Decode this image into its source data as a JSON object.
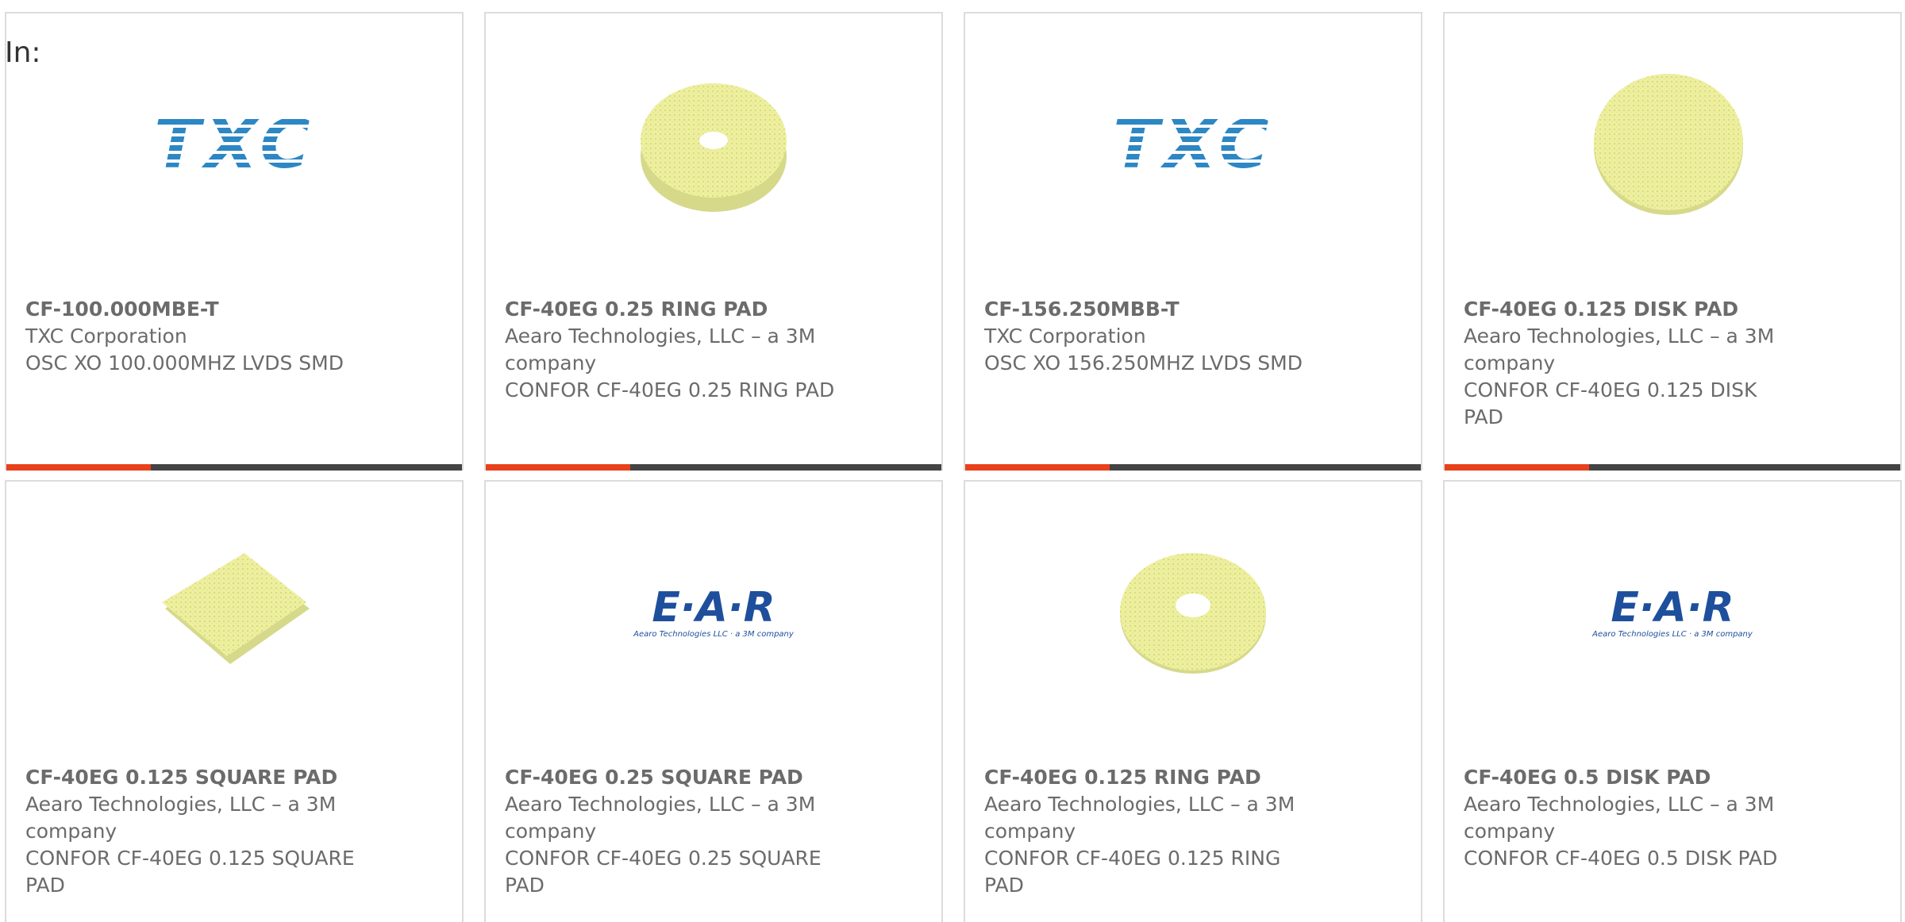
{
  "header": {
    "in_label": "In:"
  },
  "colors": {
    "accent": "#e8411c",
    "bar": "#444444",
    "txc_blue": "#2c87c4",
    "ear_blue": "#1e4f9c",
    "foam": "#eef0a0"
  },
  "products": [
    {
      "part": "CF-100.000MBE-T",
      "maker": "TXC Corporation",
      "desc": "OSC XO 100.000MHZ LVDS SMD",
      "image": "txc-logo",
      "logo_text": "TXC"
    },
    {
      "part": "CF-40EG 0.25 RING PAD",
      "maker": "Aearo Technologies, LLC – a 3M company",
      "desc": "CONFOR CF-40EG 0.25 RING PAD",
      "image": "foam-ring"
    },
    {
      "part": "CF-156.250MBB-T",
      "maker": "TXC Corporation",
      "desc": "OSC XO 156.250MHZ LVDS SMD",
      "image": "txc-logo",
      "logo_text": "TXC"
    },
    {
      "part": "CF-40EG 0.125 DISK PAD",
      "maker": "Aearo Technologies, LLC – a 3M company",
      "desc": "CONFOR CF-40EG 0.125 DISK PAD",
      "image": "foam-disk"
    },
    {
      "part": "CF-40EG 0.125 SQUARE PAD",
      "maker": "Aearo Technologies, LLC – a 3M company",
      "desc": "CONFOR CF-40EG 0.125 SQUARE PAD",
      "image": "foam-square"
    },
    {
      "part": "CF-40EG 0.25 SQUARE PAD",
      "maker": "Aearo Technologies, LLC – a 3M company",
      "desc": "CONFOR CF-40EG 0.25 SQUARE PAD",
      "image": "ear-logo",
      "logo_text": "E·A·R",
      "logo_sub": "Aearo Technologies LLC · a 3M company"
    },
    {
      "part": "CF-40EG 0.125 RING PAD",
      "maker": "Aearo Technologies, LLC – a 3M company",
      "desc": "CONFOR CF-40EG 0.125 RING PAD",
      "image": "foam-ring"
    },
    {
      "part": "CF-40EG 0.5 DISK PAD",
      "maker": "Aearo Technologies, LLC – a 3M company",
      "desc": "CONFOR CF-40EG 0.5 DISK PAD",
      "image": "ear-logo",
      "logo_text": "E·A·R",
      "logo_sub": "Aearo Technologies LLC · a 3M company"
    }
  ]
}
